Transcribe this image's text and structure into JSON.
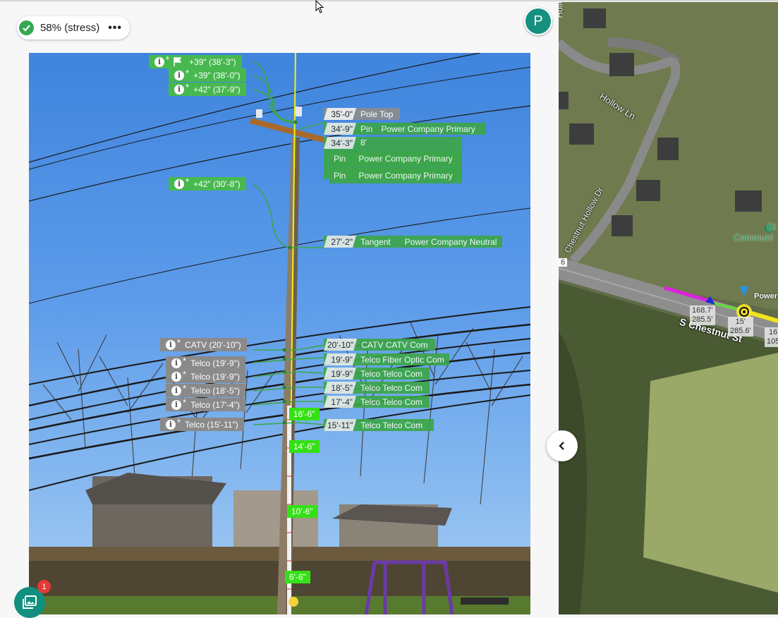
{
  "status": {
    "label": "58% (stress)",
    "more": "•••",
    "color": "#34a853"
  },
  "avatar": {
    "initial": "P",
    "color": "#16907e"
  },
  "gallery": {
    "badge_count": "1"
  },
  "attachments": [
    {
      "text": "+39\" (38'-3\")",
      "flag": true
    },
    {
      "text": "+39\" (38'-0\")",
      "flag": false
    },
    {
      "text": "+42\" (37'-9\")",
      "flag": false
    },
    {
      "text": "+42\" (30'-8\")",
      "flag": false
    }
  ],
  "comm_attachments": [
    {
      "text": "CATV  (20'-10\")"
    },
    {
      "text": "Telco  (19'-9\")"
    },
    {
      "text": "Telco  (19'-9\")"
    },
    {
      "text": "Telco  (18'-5\")"
    },
    {
      "text": "Telco  (17'-4\")"
    },
    {
      "text": "Telco  (15'-11\")"
    }
  ],
  "pole_labels": [
    {
      "height": "35'-0\"",
      "type": "Pole Top",
      "owner": ""
    },
    {
      "height": "34'-9\"",
      "type": "Pin",
      "owner": "Power Company Primary"
    },
    {
      "height": "34'-3\"",
      "type": "8'",
      "owner": ""
    },
    {
      "height": "",
      "type": "Pin",
      "owner": "Power Company Primary"
    },
    {
      "height": "",
      "type": "Pin",
      "owner": "Power Company Primary"
    },
    {
      "height": "27'-2\"",
      "type": "Tangent",
      "owner": "Power Company Neutral"
    },
    {
      "height": "20'-10\"",
      "type": "CATV CATV Com",
      "owner": ""
    },
    {
      "height": "19'-9\"",
      "type": "Telco Fiber Optic Com",
      "owner": ""
    },
    {
      "height": "19'-9\"",
      "type": "Telco Telco Com",
      "owner": ""
    },
    {
      "height": "18'-5\"",
      "type": "Telco Telco Com",
      "owner": ""
    },
    {
      "height": "17'-4\"",
      "type": "Telco Telco Com",
      "owner": ""
    },
    {
      "height": "15'-11\"",
      "type": "Telco Telco Com",
      "owner": ""
    }
  ],
  "measure_ticks": [
    "16'-6\"",
    "14'-6\"",
    "10'-6\"",
    "6'-6\""
  ],
  "map": {
    "streets": [
      "Hollow Ln",
      "Chestnut Hollow Dr",
      "S Chestnut St"
    ],
    "poi": [
      "Di",
      "Communi"
    ],
    "route_badge": "6",
    "power_label": "Power",
    "span_boxes": [
      {
        "l1": "168.7'",
        "l2": "285.5'"
      },
      {
        "l1": "15'",
        "l2": "285.6'"
      },
      {
        "l1": "16",
        "l2": "105"
      }
    ],
    "top_left_text": "Hollo"
  }
}
